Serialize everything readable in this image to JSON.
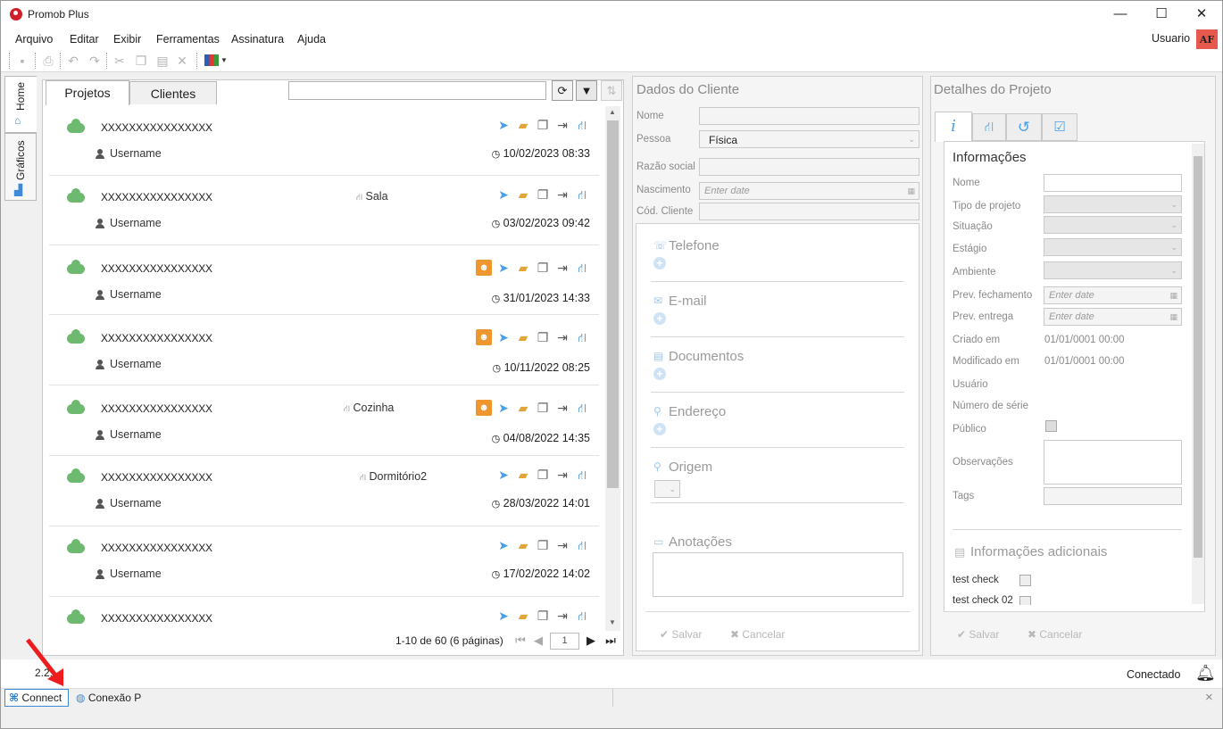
{
  "window": {
    "title": "Promob Plus",
    "minimize": "—",
    "maximize": "☐",
    "close": "✕"
  },
  "menu": [
    "Arquivo",
    "Editar",
    "Exibir",
    "Ferramentas",
    "Assinatura",
    "Ajuda"
  ],
  "user": {
    "label": "Usuario",
    "initials": "AF"
  },
  "side_tabs": [
    "Home",
    "Gráficos"
  ],
  "project_tabs": [
    "Projetos",
    "Clientes"
  ],
  "search": {
    "value": ""
  },
  "projects": [
    {
      "name": "XXXXXXXXXXXXXXXX",
      "room": "",
      "user": "Username",
      "date": "10/02/2023 08:33",
      "assigned": false
    },
    {
      "name": "XXXXXXXXXXXXXXXX",
      "room": "Sala",
      "user": "Username",
      "date": "03/02/2023 09:42",
      "assigned": false
    },
    {
      "name": "XXXXXXXXXXXXXXXX",
      "room": "",
      "user": "Username",
      "date": "31/01/2023 14:33",
      "assigned": true
    },
    {
      "name": "XXXXXXXXXXXXXXXX",
      "room": "",
      "user": "Username",
      "date": "10/11/2022 08:25",
      "assigned": true
    },
    {
      "name": "XXXXXXXXXXXXXXXX",
      "room": "Cozinha",
      "user": "Username",
      "date": "04/08/2022 14:35",
      "assigned": true
    },
    {
      "name": "XXXXXXXXXXXXXXXX",
      "room": "Dormitório2",
      "user": "Username",
      "date": "28/03/2022 14:01",
      "assigned": false
    },
    {
      "name": "XXXXXXXXXXXXXXXX",
      "room": "",
      "user": "Username",
      "date": "17/02/2022 14:02",
      "assigned": false
    },
    {
      "name": "XXXXXXXXXXXXXXXX",
      "room": "",
      "user": "",
      "date": "",
      "assigned": false
    }
  ],
  "pager": {
    "text": "1-10 de 60 (6 páginas)",
    "page": "1"
  },
  "cliente": {
    "title": "Dados do Cliente",
    "nome_label": "Nome",
    "pessoa_label": "Pessoa",
    "pessoa_value": "Física",
    "razao_label": "Razão social",
    "nascimento_label": "Nascimento",
    "nascimento_placeholder": "Enter date",
    "cod_label": "Cód. Cliente",
    "sections": [
      "Telefone",
      "E-mail",
      "Documentos",
      "Endereço",
      "Origem",
      "Anotações"
    ],
    "save": "Salvar",
    "cancel": "Cancelar"
  },
  "detalhes": {
    "title": "Detalhes do Projeto",
    "info_title": "Informações",
    "fields": {
      "nome": "Nome",
      "tipo": "Tipo de projeto",
      "situacao": "Situação",
      "estagio": "Estágio",
      "ambiente": "Ambiente",
      "prev_fech": "Prev. fechamento",
      "prev_entrega": "Prev. entrega",
      "criado": "Criado em",
      "modificado": "Modificado em",
      "usuario": "Usuário",
      "serie": "Número de série",
      "publico": "Público",
      "obs": "Observações",
      "tags": "Tags"
    },
    "date_placeholder": "Enter date",
    "criado_value": "01/01/0001 00:00",
    "modificado_value": "01/01/0001 00:00",
    "add_info": "Informações adicionais",
    "checks": [
      "test check",
      "test check 02"
    ],
    "save": "Salvar",
    "cancel": "Cancelar"
  },
  "status": {
    "version": "2.2.",
    "connection": "Conectado"
  },
  "taskbar": {
    "connect": "Connect",
    "conexao": "Conexão P",
    "close": "×"
  }
}
